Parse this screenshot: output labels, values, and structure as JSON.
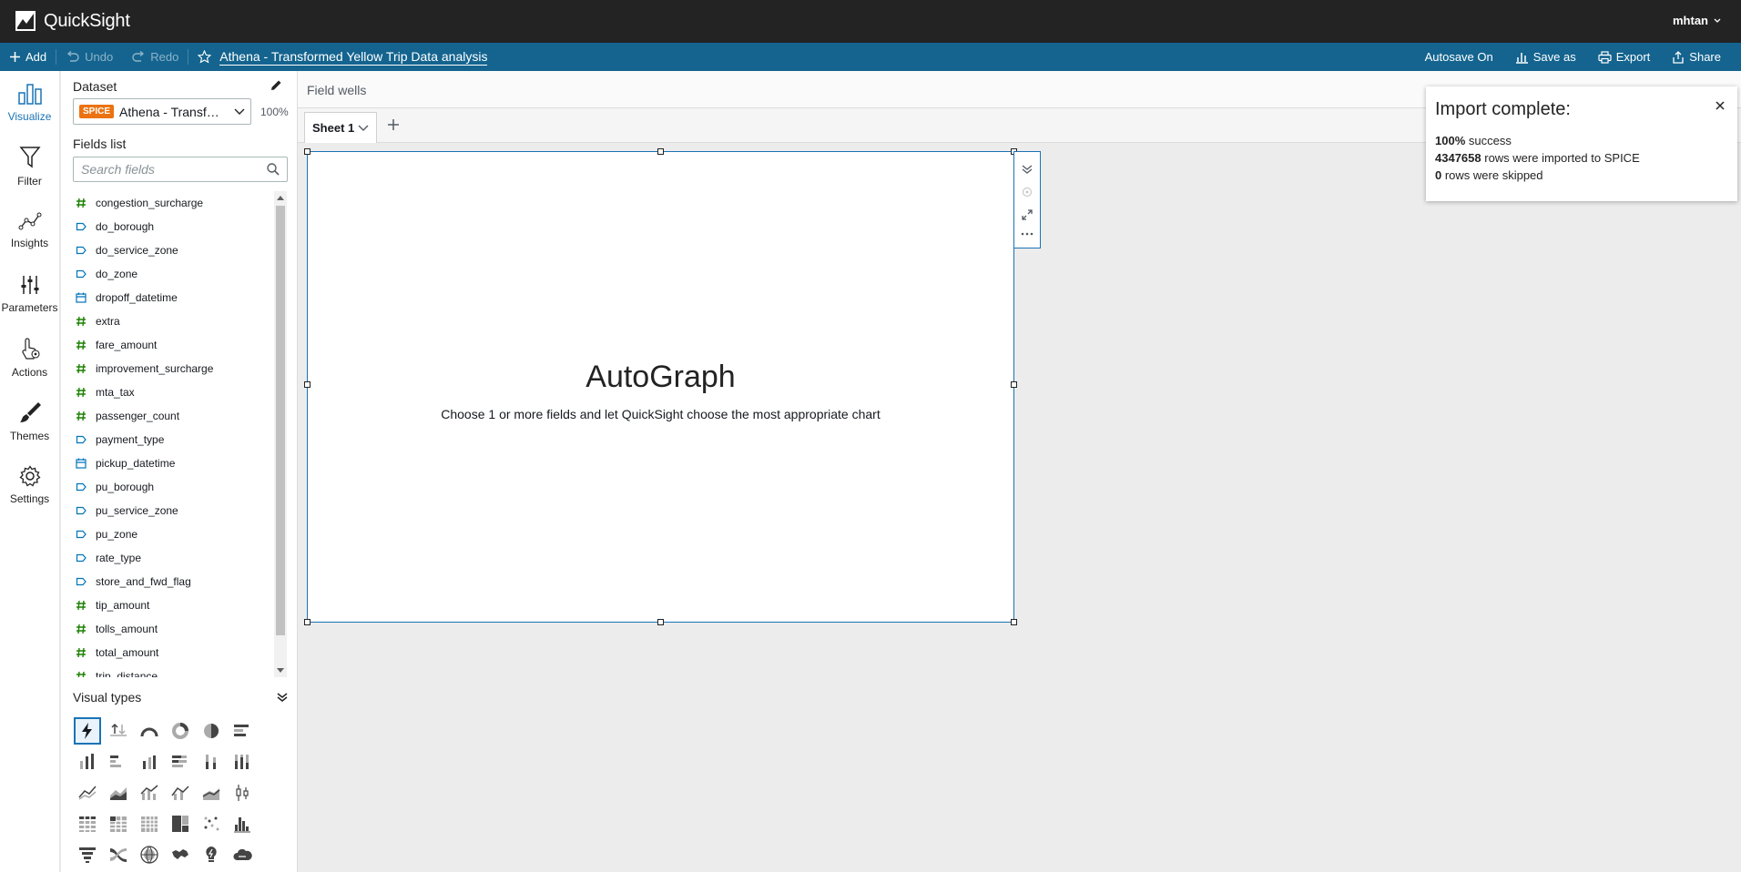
{
  "app": {
    "name": "QuickSight",
    "user": "mhtan"
  },
  "toolbar": {
    "add": "Add",
    "undo": "Undo",
    "redo": "Redo",
    "analysis_title": "Athena - Transformed Yellow Trip Data analysis",
    "autosave": "Autosave On",
    "save_as": "Save as",
    "export": "Export",
    "share": "Share"
  },
  "rail": [
    {
      "label": "Visualize",
      "icon": "visualize-icon"
    },
    {
      "label": "Filter",
      "icon": "filter-icon"
    },
    {
      "label": "Insights",
      "icon": "insights-icon"
    },
    {
      "label": "Parameters",
      "icon": "parameters-icon"
    },
    {
      "label": "Actions",
      "icon": "actions-icon"
    },
    {
      "label": "Themes",
      "icon": "themes-icon"
    },
    {
      "label": "Settings",
      "icon": "settings-icon"
    }
  ],
  "dataset": {
    "label": "Dataset",
    "badge": "SPICE",
    "name": "Athena - Transf…",
    "percent": "100%"
  },
  "fields_list": {
    "label": "Fields list",
    "search_placeholder": "Search fields",
    "items": [
      {
        "name": "congestion_surcharge",
        "type": "measure"
      },
      {
        "name": "do_borough",
        "type": "dimension"
      },
      {
        "name": "do_service_zone",
        "type": "dimension"
      },
      {
        "name": "do_zone",
        "type": "dimension"
      },
      {
        "name": "dropoff_datetime",
        "type": "date"
      },
      {
        "name": "extra",
        "type": "measure"
      },
      {
        "name": "fare_amount",
        "type": "measure"
      },
      {
        "name": "improvement_surcharge",
        "type": "measure"
      },
      {
        "name": "mta_tax",
        "type": "measure"
      },
      {
        "name": "passenger_count",
        "type": "measure"
      },
      {
        "name": "payment_type",
        "type": "dimension"
      },
      {
        "name": "pickup_datetime",
        "type": "date"
      },
      {
        "name": "pu_borough",
        "type": "dimension"
      },
      {
        "name": "pu_service_zone",
        "type": "dimension"
      },
      {
        "name": "pu_zone",
        "type": "dimension"
      },
      {
        "name": "rate_type",
        "type": "dimension"
      },
      {
        "name": "store_and_fwd_flag",
        "type": "dimension"
      },
      {
        "name": "tip_amount",
        "type": "measure"
      },
      {
        "name": "tolls_amount",
        "type": "measure"
      },
      {
        "name": "total_amount",
        "type": "measure"
      },
      {
        "name": "trip_distance",
        "type": "measure"
      }
    ]
  },
  "visual_types": {
    "label": "Visual types",
    "count": 31
  },
  "field_wells": "Field wells",
  "sheet": {
    "tab": "Sheet 1"
  },
  "autograph": {
    "title": "AutoGraph",
    "subtitle": "Choose 1 or more fields and let QuickSight choose the most appropriate chart"
  },
  "toast": {
    "title": "Import complete:",
    "l1_bold": "100%",
    "l1_rest": " success",
    "l2_bold": "4347658",
    "l2_rest": " rows were imported to SPICE",
    "l3_bold": "0",
    "l3_rest": " rows were skipped"
  },
  "colors": {
    "measure": "#1d8102",
    "dimension": "#0073bb",
    "accent": "#1a73b5",
    "toolbar": "#14648f",
    "spice": "#ec7211"
  }
}
